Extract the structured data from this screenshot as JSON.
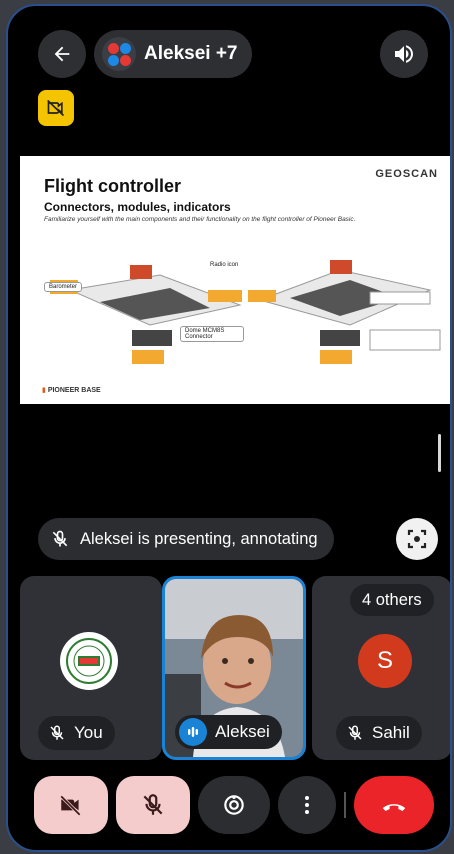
{
  "header": {
    "title": "Aleksei +7"
  },
  "slide": {
    "brand": "GEOSCAN",
    "title": "Flight controller",
    "subtitle": "Connectors, modules, indicators",
    "description": "Familiarize yourself with the main components and their functionality on the flight controller of Pioneer Basic.",
    "label_radio": "Radio icon",
    "label_barometer": "Barometer",
    "label_connector": "Dome MCM8S Connector",
    "footer": "PIONEER BASE"
  },
  "presenting": {
    "text": "Aleksei is presenting, annotating"
  },
  "tiles": {
    "you": {
      "name": "You"
    },
    "main": {
      "name": "Aleksei"
    },
    "others": {
      "count_label": "4 others",
      "name": "Sahil",
      "initial": "S"
    }
  },
  "colors": {
    "end_call": "#ea2429",
    "active_tile_border": "#1a83d6",
    "notice": "#f5c400",
    "muted_control": "#f4cccc"
  }
}
